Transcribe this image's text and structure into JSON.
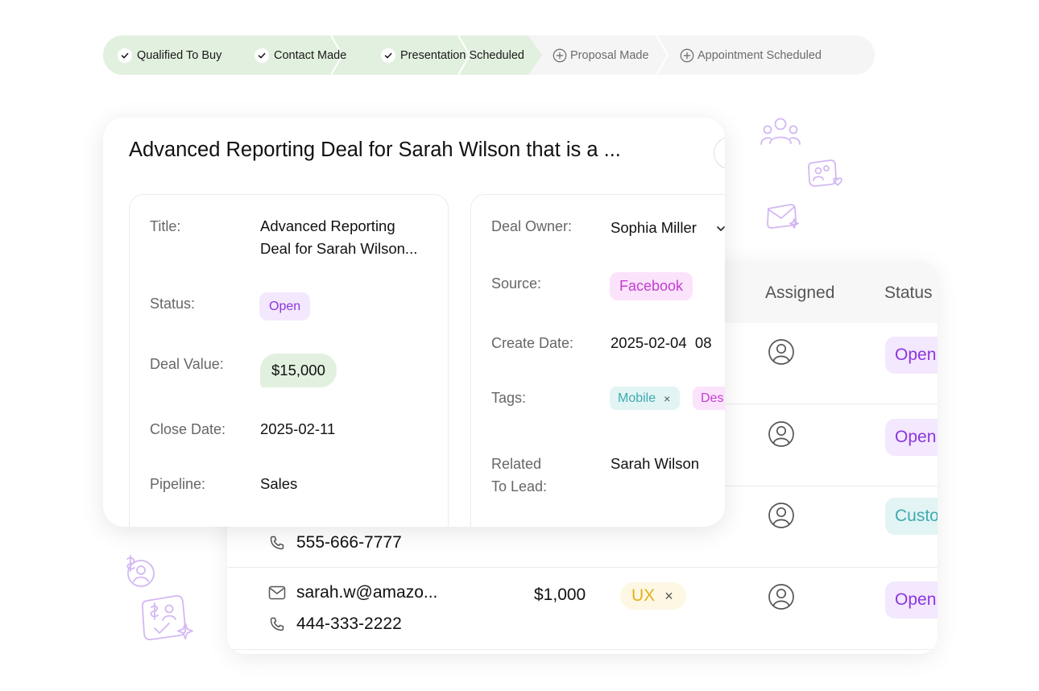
{
  "pipeline": {
    "stages": [
      {
        "label": "Qualified To Buy",
        "state": "done"
      },
      {
        "label": "Contact Made",
        "state": "done"
      },
      {
        "label": "Presentation Scheduled",
        "state": "done"
      },
      {
        "label": "Proposal Made",
        "state": "todo"
      },
      {
        "label": "Appointment Scheduled",
        "state": "todo"
      }
    ],
    "colors": {
      "done_bg": "#e2f1df",
      "todo_bg": "#f5f5f5"
    }
  },
  "deal": {
    "title": "Advanced Reporting Deal for Sarah Wilson that is a ...",
    "left": {
      "title_label": "Title:",
      "title_line1": "Advanced Reporting",
      "title_line2": "Deal for Sarah Wilson...",
      "status_label": "Status:",
      "status_value": "Open",
      "value_label": "Deal Value:",
      "value_value": "$15,000",
      "close_label": "Close Date:",
      "close_value": "2025-02-11",
      "pipeline_label": "Pipeline:",
      "pipeline_value": "Sales"
    },
    "right": {
      "owner_label": "Deal Owner:",
      "owner_value": "Sophia Miller",
      "source_label": "Source:",
      "source_value": "Facebook",
      "create_label": "Create Date:",
      "create_value": "2025-02-04  08",
      "tags_label": "Tags:",
      "tags": [
        {
          "label": "Mobile",
          "remove": "×"
        },
        {
          "label": "Des"
        }
      ],
      "related_label_line1": "Related",
      "related_label_line2": "To Lead:",
      "related_value": "Sarah Wilson"
    }
  },
  "table": {
    "headers": {
      "assigned": "Assigned",
      "status": "Status"
    },
    "rows": [
      {
        "status": "Open",
        "status_type": "open"
      },
      {
        "status": "Open",
        "status_type": "open"
      },
      {
        "phone": "555-666-7777",
        "status": "Custo",
        "status_type": "customer"
      },
      {
        "email": "sarah.w@amazo...",
        "phone": "444-333-2222",
        "amount": "$1,000",
        "tag": "UX",
        "tag_remove": "×",
        "status": "Open",
        "status_type": "open"
      }
    ],
    "colors": {
      "open_bg": "#f3e8fd",
      "open_fg": "#8c35e0",
      "customer_bg": "#e2f4f4",
      "customer_fg": "#3eaab0"
    }
  },
  "icons": {
    "check": "check-icon",
    "plus": "plus-circle-icon",
    "user": "user-circle-icon",
    "mail": "mail-icon",
    "phone": "phone-icon",
    "chevron": "chevron-down-icon"
  }
}
